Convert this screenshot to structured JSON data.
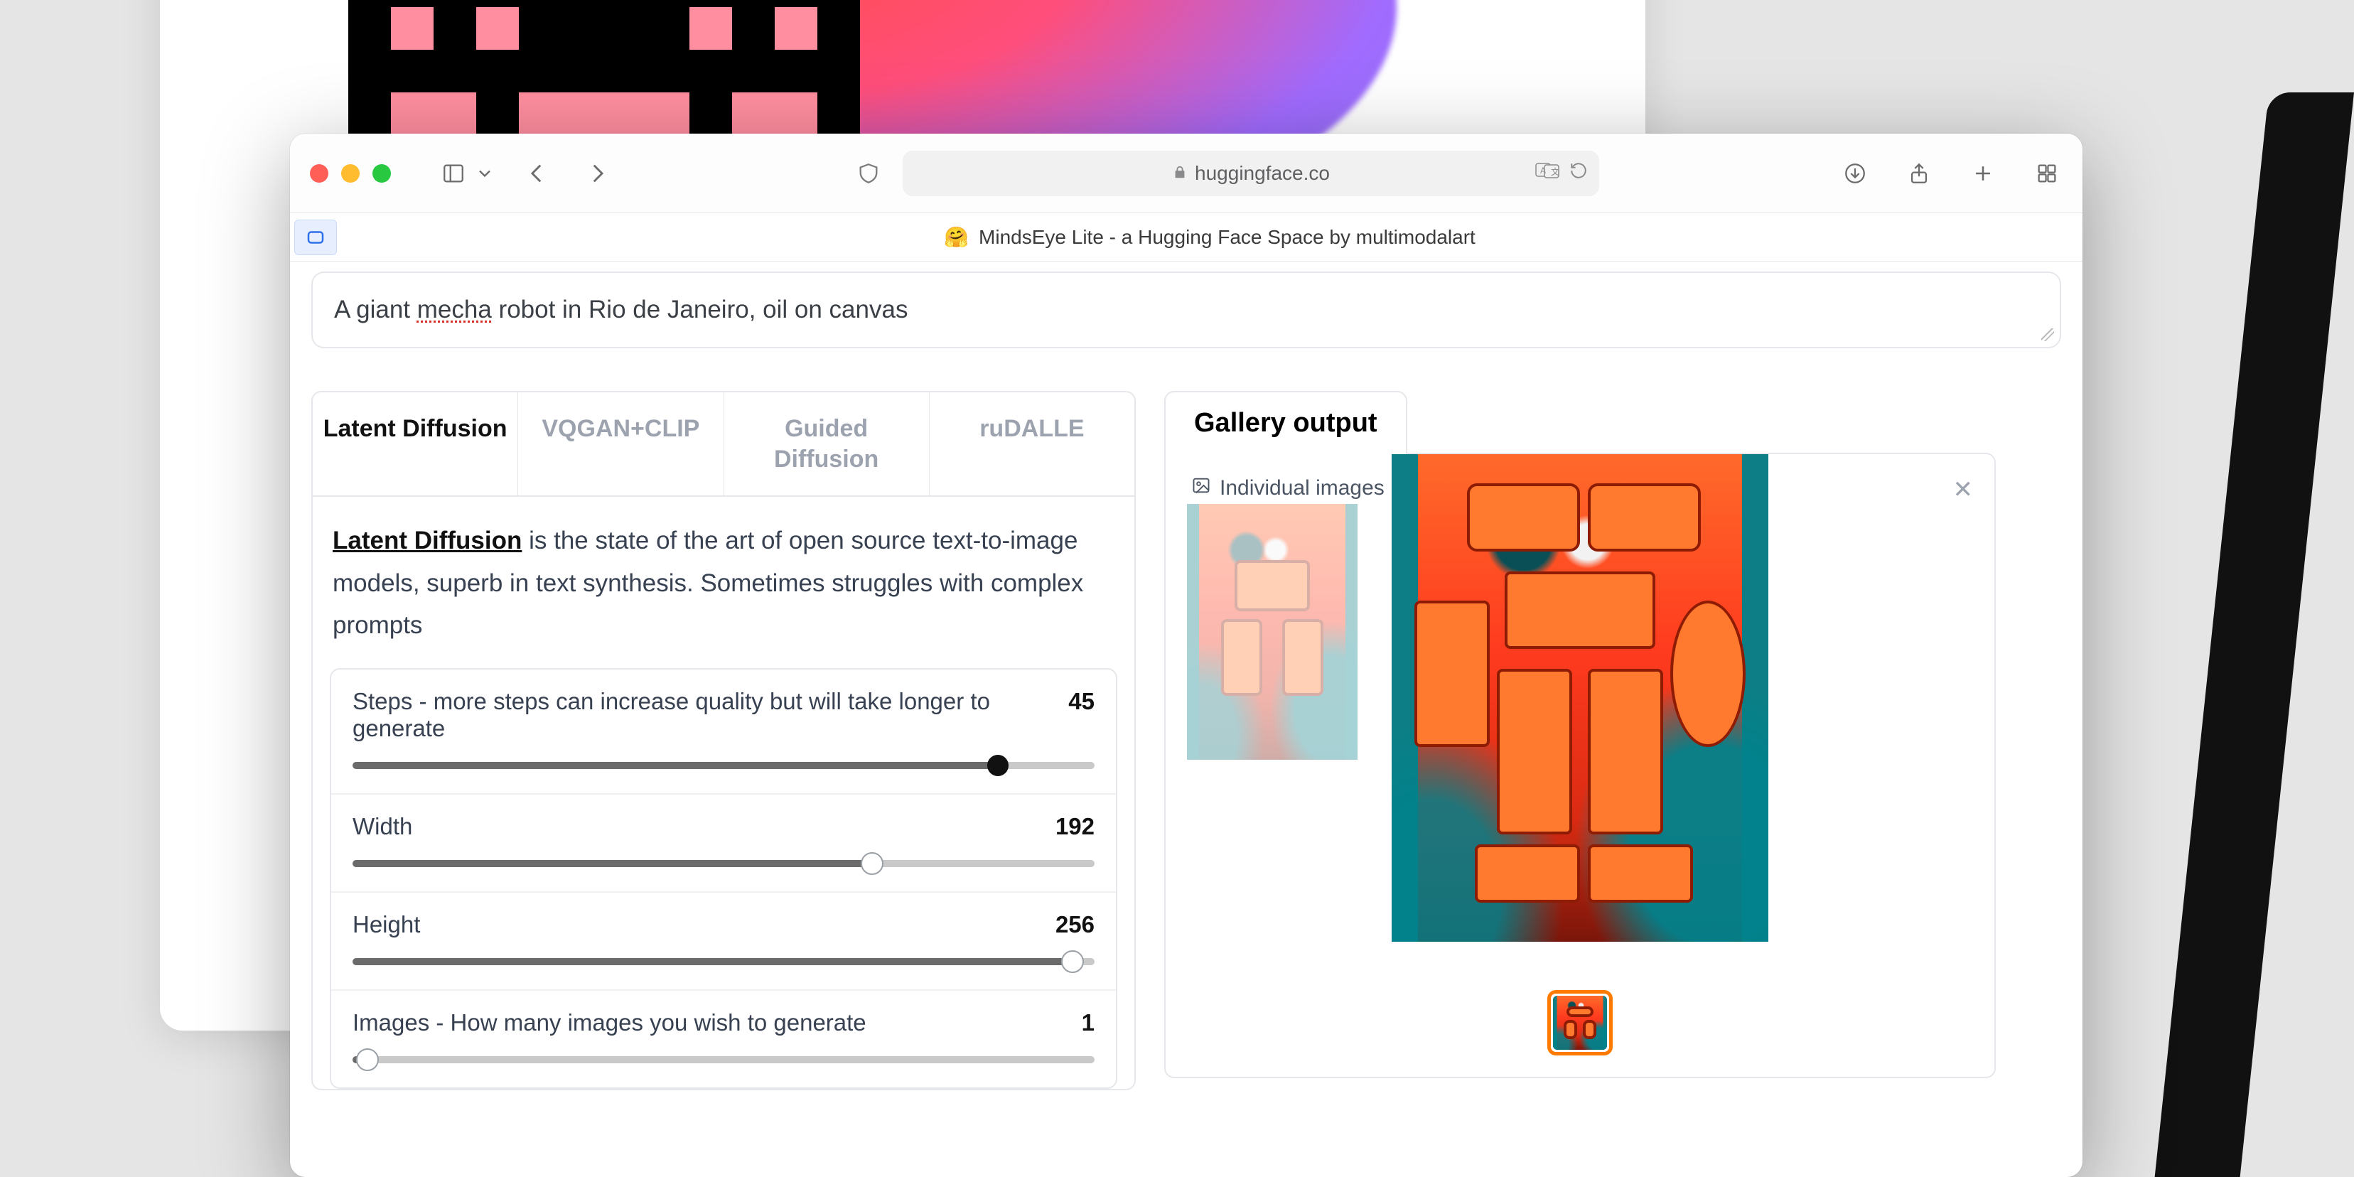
{
  "browser": {
    "address_host": "huggingface.co",
    "page_title": "MindsEye Lite - a Hugging Face Space by multimodalart"
  },
  "prompt": {
    "value_pre": "A giant ",
    "value_spell": "mecha",
    "value_post": " robot in Rio de Janeiro, oil on canvas"
  },
  "tabs": [
    {
      "label": "Latent Diffusion",
      "active": true
    },
    {
      "label": "VQGAN+CLIP",
      "active": false
    },
    {
      "label": "Guided Diffusion",
      "active": false
    },
    {
      "label": "ruDALLE",
      "active": false
    }
  ],
  "desc": {
    "link": "Latent Diffusion",
    "rest": " is the state of the art of open source text-to-image models, superb in text synthesis. Sometimes struggles with complex prompts"
  },
  "sliders": {
    "steps": {
      "label": "Steps - more steps can increase quality but will take longer to generate",
      "value": "45",
      "pct": 87
    },
    "width": {
      "label": "Width",
      "value": "192",
      "pct": 70
    },
    "height": {
      "label": "Height",
      "value": "256",
      "pct": 97
    },
    "images": {
      "label": "Images - How many images you wish to generate",
      "value": "1",
      "pct": 2
    }
  },
  "gallery": {
    "tab": "Gallery output",
    "badge": "Individual images"
  }
}
